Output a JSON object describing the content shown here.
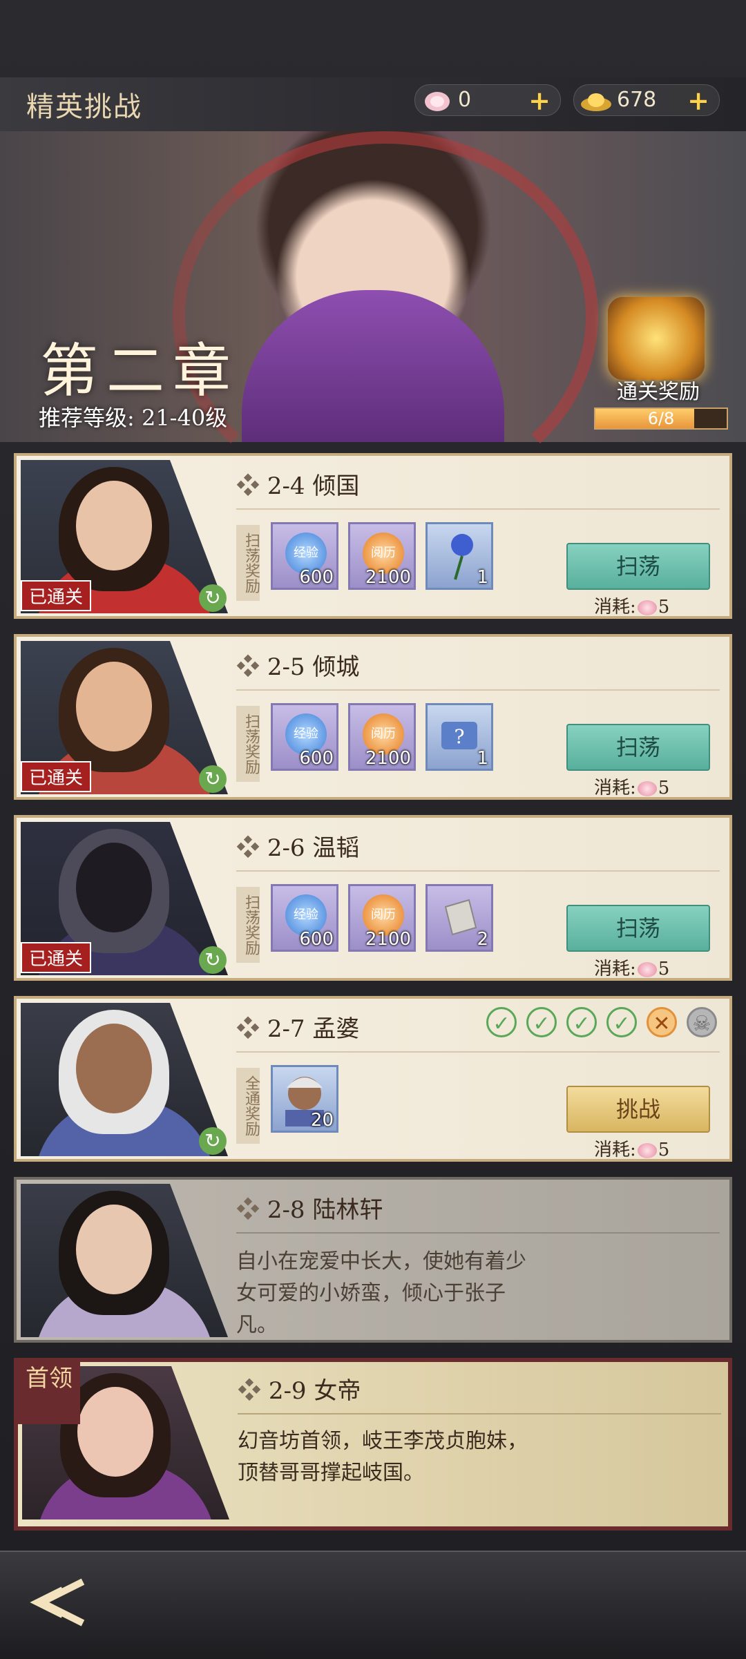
{
  "header": {
    "title": "精英挑战",
    "resources": [
      {
        "name": "peach",
        "value": "0"
      },
      {
        "name": "gold",
        "value": "678"
      }
    ]
  },
  "banner": {
    "chapter": "第二章",
    "recommend": "推荐等级: 21-40级",
    "reward_label": "通关奖励",
    "progress": "6/8",
    "progress_fraction": 0.75
  },
  "reward_vertical": "扫荡奖励",
  "full_reward_vertical": "全通奖励",
  "cleared_label": "已通关",
  "sweep_label": "扫荡",
  "challenge_label": "挑战",
  "cost_prefix": "消耗:",
  "cost_value": "5",
  "stages": [
    {
      "id": "2-4",
      "name": "倾国",
      "items": [
        {
          "label": "经验",
          "qty": "600"
        },
        {
          "label": "阅历",
          "qty": "2100"
        },
        {
          "label": "rose",
          "qty": "1"
        }
      ]
    },
    {
      "id": "2-5",
      "name": "倾城",
      "items": [
        {
          "label": "经验",
          "qty": "600"
        },
        {
          "label": "阅历",
          "qty": "2100"
        },
        {
          "label": "map",
          "qty": "1"
        }
      ]
    },
    {
      "id": "2-6",
      "name": "温韬",
      "items": [
        {
          "label": "经验",
          "qty": "600"
        },
        {
          "label": "阅历",
          "qty": "2100"
        },
        {
          "label": "ore",
          "qty": "2"
        }
      ]
    },
    {
      "id": "2-7",
      "name": "孟婆",
      "items": [
        {
          "label": "portrait",
          "qty": "20"
        }
      ]
    },
    {
      "id": "2-8",
      "name": "陆林轩",
      "desc": "自小在宠爱中长大，使她有着少女可爱的小娇蛮，倾心于张子凡。"
    },
    {
      "id": "2-9",
      "name": "女帝",
      "desc": "幻音坊首领，岐王李茂贞胞妹，顶替哥哥撑起岐国。",
      "tag": "首领"
    }
  ],
  "colors": {
    "accent": "#58b09c",
    "gold_button": "#d8b561",
    "boss_frame": "#6a2b2e"
  }
}
